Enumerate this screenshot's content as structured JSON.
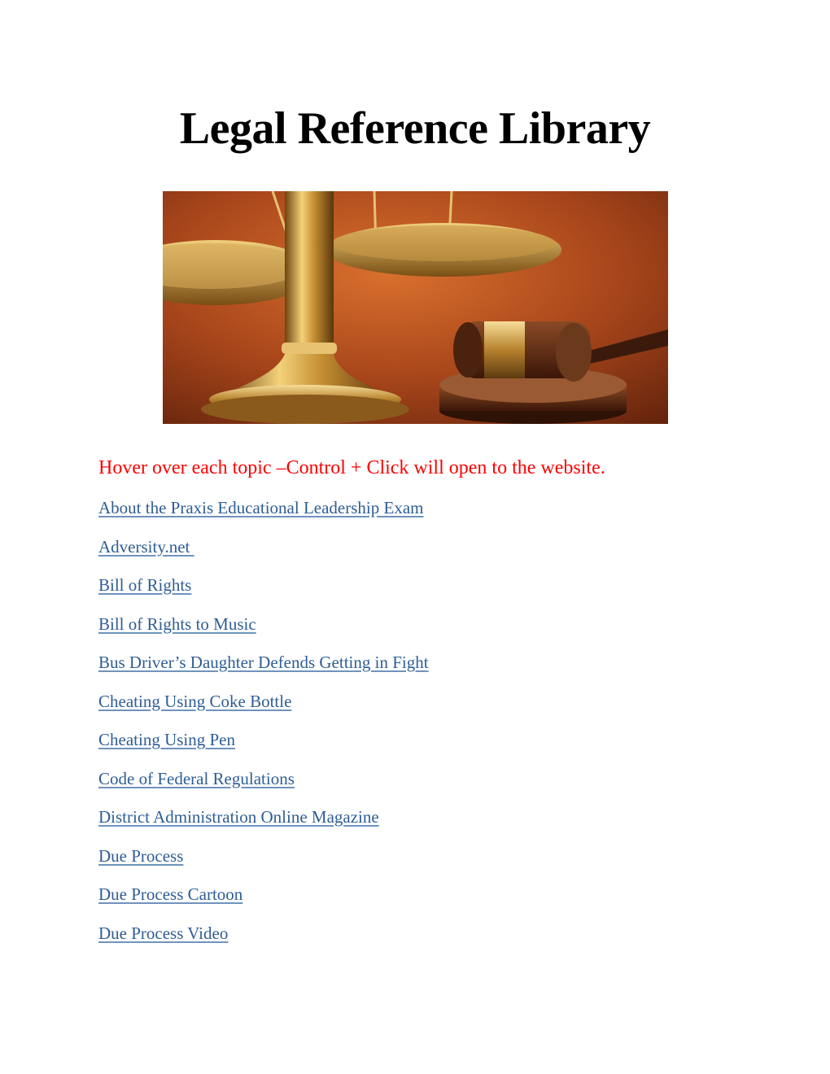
{
  "page": {
    "title": "Legal Reference Library",
    "hero_image": {
      "alt": "Scales of justice and a judge's gavel on a wooden table",
      "icon": "scales-and-gavel-photo"
    },
    "instruction": "Hover over each topic –Control + Click will open to the website.",
    "colors": {
      "instruction": "#ff0000",
      "link": "#2e5d95"
    },
    "links": [
      {
        "label": "About the Praxis Educational Leadership Exam"
      },
      {
        "label": "Adversity.net "
      },
      {
        "label": "Bill of Rights"
      },
      {
        "label": "Bill of Rights to Music"
      },
      {
        "label": "Bus Driver’s Daughter Defends Getting in Fight"
      },
      {
        "label": "Cheating Using Coke Bottle"
      },
      {
        "label": "Cheating Using Pen"
      },
      {
        "label": "Code of Federal Regulations"
      },
      {
        "label": "District Administration Online Magazine"
      },
      {
        "label": "Due Process"
      },
      {
        "label": "Due Process Cartoon"
      },
      {
        "label": "Due Process Video"
      }
    ]
  }
}
